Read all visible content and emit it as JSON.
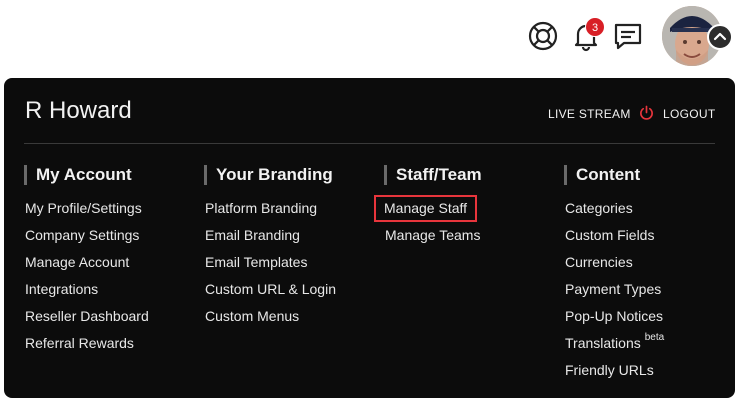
{
  "topbar": {
    "notification_count": "3",
    "icons": [
      "lifebuoy-icon",
      "bell-icon",
      "chat-icon",
      "chevron-up-icon"
    ]
  },
  "user": {
    "name": "R Howard"
  },
  "actions": {
    "live_stream": "LIVE STREAM",
    "logout": "LOGOUT"
  },
  "colors": {
    "panel_bg": "#0c0c0c",
    "badge": "#d81f26",
    "highlight": "#e8353c"
  },
  "menu": {
    "columns": [
      {
        "title": "My Account",
        "items": [
          "My Profile/Settings",
          "Company Settings",
          "Manage Account",
          "Integrations",
          "Reseller Dashboard",
          "Referral Rewards"
        ]
      },
      {
        "title": "Your Branding",
        "items": [
          "Platform Branding",
          "Email Branding",
          "Email Templates",
          "Custom URL & Login",
          "Custom Menus"
        ]
      },
      {
        "title": "Staff/Team",
        "items": [
          "Manage Staff",
          "Manage Teams"
        ]
      },
      {
        "title": "Content",
        "items": [
          "Categories",
          "Custom Fields",
          "Currencies",
          "Payment Types",
          "Pop-Up Notices",
          "Translations",
          "Friendly URLs"
        ],
        "translations_badge": "beta"
      }
    ]
  }
}
